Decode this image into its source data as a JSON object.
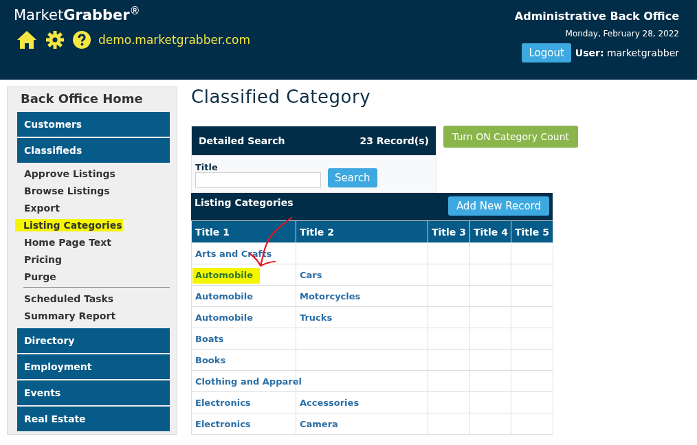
{
  "header": {
    "brand_light": "Market",
    "brand_bold": "Grabber",
    "brand_mark": "®",
    "site": "demo.marketgrabber.com",
    "office_title": "Administrative Back Office",
    "date": "Monday, February 28, 2022",
    "logout": "Logout",
    "user_label": "User:",
    "user_name": "marketgrabber"
  },
  "sidebar": {
    "title": "Back Office Home",
    "sections": [
      {
        "label": "Customers"
      },
      {
        "label": "Classifieds",
        "items": [
          {
            "label": "Approve Listings",
            "highlighted": false,
            "divider_before": false
          },
          {
            "label": "Browse Listings",
            "highlighted": false,
            "divider_before": false
          },
          {
            "label": "Export",
            "highlighted": false,
            "divider_before": false
          },
          {
            "label": "Listing Categories",
            "highlighted": true,
            "divider_before": false
          },
          {
            "label": "Home Page Text",
            "highlighted": false,
            "divider_before": false
          },
          {
            "label": "Pricing",
            "highlighted": false,
            "divider_before": false
          },
          {
            "label": "Purge",
            "highlighted": false,
            "divider_before": false
          },
          {
            "label": "Scheduled Tasks",
            "highlighted": false,
            "divider_before": true
          },
          {
            "label": "Summary Report",
            "highlighted": false,
            "divider_before": false
          }
        ]
      },
      {
        "label": "Directory"
      },
      {
        "label": "Employment"
      },
      {
        "label": "Events"
      },
      {
        "label": "Real Estate"
      }
    ]
  },
  "page_title": "Classified Category",
  "search_panel": {
    "title": "Detailed Search",
    "count": "23 Record(s)",
    "field_label": "Title",
    "button": "Search"
  },
  "category_count_button": "Turn ON Category Count",
  "table": {
    "title": "Listing Categories",
    "add_button": "Add New Record",
    "columns": [
      "Title 1",
      "Title 2",
      "Title 3",
      "Title 4",
      "Title 5"
    ],
    "rows": [
      {
        "cells": [
          "Arts and Crafts",
          "",
          "",
          "",
          ""
        ],
        "highlighted": false
      },
      {
        "cells": [
          "Automobile",
          "Cars",
          "",
          "",
          ""
        ],
        "highlighted": true
      },
      {
        "cells": [
          "Automobile",
          "Motorcycles",
          "",
          "",
          ""
        ],
        "highlighted": false
      },
      {
        "cells": [
          "Automobile",
          "Trucks",
          "",
          "",
          ""
        ],
        "highlighted": false
      },
      {
        "cells": [
          "Boats",
          "",
          "",
          "",
          ""
        ],
        "highlighted": false
      },
      {
        "cells": [
          "Books",
          "",
          "",
          "",
          ""
        ],
        "highlighted": false
      },
      {
        "cells": [
          "Clothing and Apparel",
          "",
          "",
          "",
          ""
        ],
        "highlighted": false
      },
      {
        "cells": [
          "Electronics",
          "Accessories",
          "",
          "",
          ""
        ],
        "highlighted": false
      },
      {
        "cells": [
          "Electronics",
          "Camera",
          "",
          "",
          ""
        ],
        "highlighted": false
      }
    ]
  }
}
